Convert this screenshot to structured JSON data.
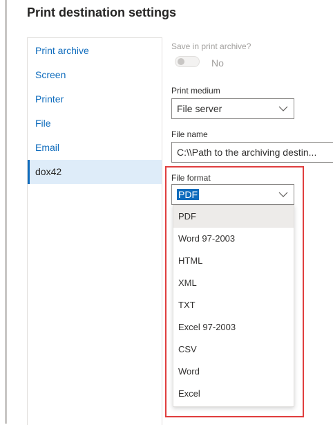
{
  "page": {
    "title": "Print destination settings"
  },
  "destinations": {
    "items": [
      {
        "label": "Print archive",
        "selected": false
      },
      {
        "label": "Screen",
        "selected": false
      },
      {
        "label": "Printer",
        "selected": false
      },
      {
        "label": "File",
        "selected": false
      },
      {
        "label": "Email",
        "selected": false
      },
      {
        "label": "dox42",
        "selected": true
      }
    ]
  },
  "settings": {
    "save_in_archive": {
      "label": "Save in print archive?",
      "value": "No",
      "enabled": false
    },
    "print_medium": {
      "label": "Print medium",
      "value": "File server"
    },
    "file_name": {
      "label": "File name",
      "value": "C:\\\\Path to the archiving destin..."
    },
    "file_format": {
      "label": "File format",
      "value": "PDF",
      "options": [
        "PDF",
        "Word 97-2003",
        "HTML",
        "XML",
        "TXT",
        "Excel 97-2003",
        "CSV",
        "Word",
        "Excel"
      ]
    }
  },
  "icons": {
    "dropdown": "chevron-down-icon"
  },
  "colors": {
    "accent": "#0f6cbd",
    "highlight": "#e03e3e",
    "selected_bg": "#deecf9"
  }
}
